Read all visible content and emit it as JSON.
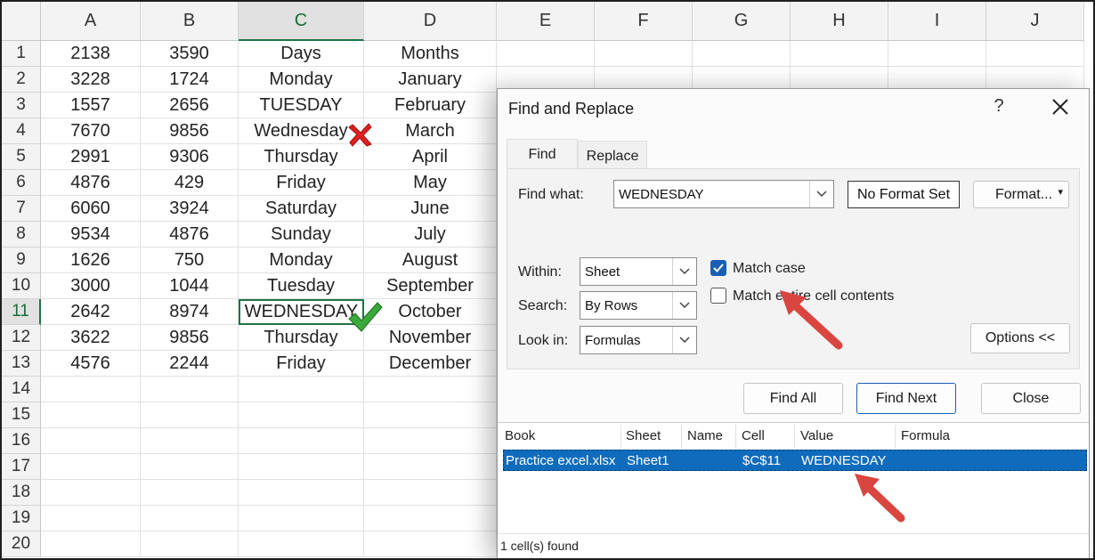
{
  "spreadsheet": {
    "columns": [
      "A",
      "B",
      "C",
      "D",
      "E",
      "F",
      "G",
      "H",
      "I",
      "J"
    ],
    "selected_column": "C",
    "selected_row": 11,
    "row_numbers": [
      "1",
      "2",
      "3",
      "4",
      "5",
      "6",
      "7",
      "8",
      "9",
      "10",
      "11",
      "12",
      "13",
      "14",
      "15",
      "16",
      "17",
      "18",
      "19",
      "20"
    ],
    "rows": [
      [
        "2138",
        "3590",
        "Days",
        "Months"
      ],
      [
        "3228",
        "1724",
        "Monday",
        "January"
      ],
      [
        "1557",
        "2656",
        "TUESDAY",
        "February"
      ],
      [
        "7670",
        "9856",
        "Wednesday",
        "March"
      ],
      [
        "2991",
        "9306",
        "Thursday",
        "April"
      ],
      [
        "4876",
        "429",
        "Friday",
        "May"
      ],
      [
        "6060",
        "3924",
        "Saturday",
        "June"
      ],
      [
        "9534",
        "4876",
        "Sunday",
        "July"
      ],
      [
        "1626",
        "750",
        "Monday",
        "August"
      ],
      [
        "3000",
        "1044",
        "Tuesday",
        "September"
      ],
      [
        "2642",
        "8974",
        "WEDNESDAY",
        "October"
      ],
      [
        "3622",
        "9856",
        "Thursday",
        "November"
      ],
      [
        "4576",
        "2244",
        "Friday",
        "December"
      ]
    ],
    "annotations": {
      "wrong_match_icon": "cross-mark-icon",
      "correct_match_icon": "check-mark-icon"
    }
  },
  "dialog": {
    "title": "Find and Replace",
    "help": "?",
    "tabs": {
      "find": "Find",
      "replace": "Replace"
    },
    "find_what_label": "Find what:",
    "find_what_value": "WEDNESDAY",
    "no_format": "No Format Set",
    "format_button": "Format...",
    "within_label": "Within:",
    "within_value": "Sheet",
    "search_label": "Search:",
    "search_value": "By Rows",
    "lookin_label": "Look in:",
    "lookin_value": "Formulas",
    "match_case_label": "Match case",
    "match_case_checked": true,
    "match_entire_label": "Match entire cell contents",
    "match_entire_checked": false,
    "options_button": "Options <<",
    "find_all_button": "Find All",
    "find_next_button": "Find Next",
    "close_button": "Close",
    "results": {
      "headers": [
        "Book",
        "Sheet",
        "Name",
        "Cell",
        "Value",
        "Formula"
      ],
      "row": [
        "Practice excel.xlsx",
        "Sheet1",
        "",
        "$C$11",
        "WEDNESDAY",
        ""
      ],
      "footer": "1 cell(s) found"
    }
  },
  "colors": {
    "excel_green": "#217346",
    "selection_blue": "#0f6cbd",
    "arrow_red": "#d9453f"
  }
}
